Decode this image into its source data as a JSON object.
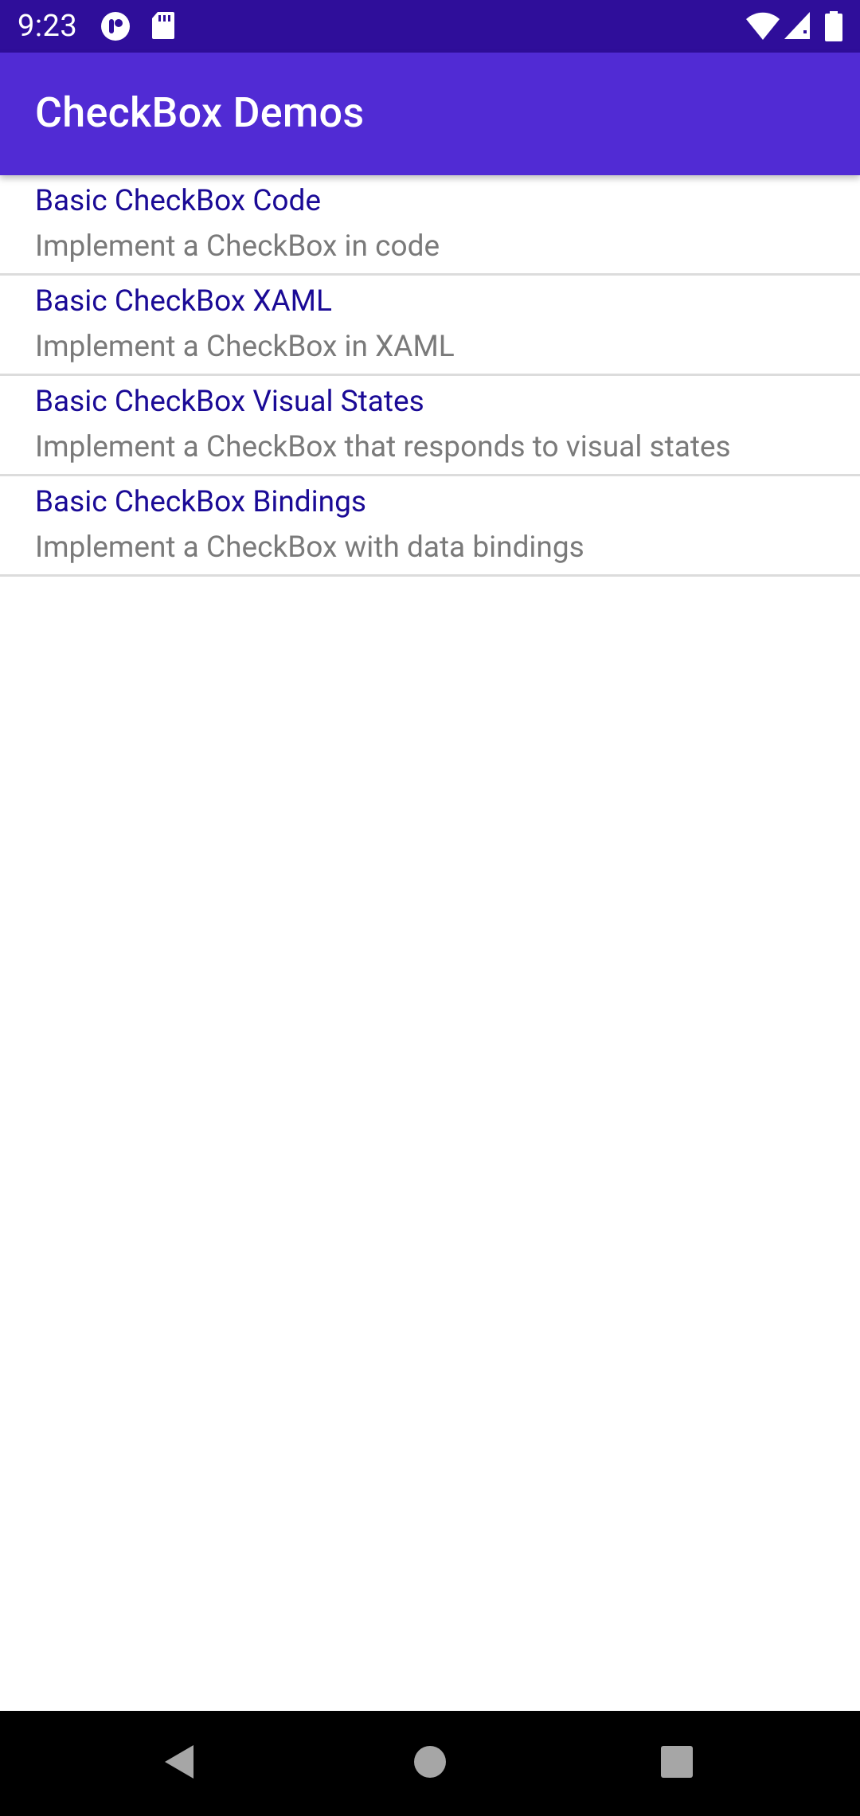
{
  "status_bar": {
    "time": "9:23",
    "left_icons": [
      "notification-app-icon",
      "sd-card-icon"
    ],
    "right_icons": [
      "wifi-icon",
      "cell-signal-icon",
      "battery-icon"
    ],
    "background": "#2f0e9a"
  },
  "app_bar": {
    "title": "CheckBox Demos",
    "background": "#512bd4"
  },
  "list": {
    "title_color": "#1a0a96",
    "description_color": "#7a7a7a",
    "items": [
      {
        "title": "Basic CheckBox Code",
        "description": "Implement a CheckBox in code"
      },
      {
        "title": "Basic CheckBox XAML",
        "description": "Implement a CheckBox in XAML"
      },
      {
        "title": "Basic CheckBox Visual States",
        "description": "Implement a CheckBox that responds to visual states"
      },
      {
        "title": "Basic CheckBox Bindings",
        "description": "Implement a CheckBox with data bindings"
      }
    ]
  },
  "nav_bar": {
    "buttons": [
      "back-icon",
      "home-icon",
      "recents-icon"
    ]
  }
}
